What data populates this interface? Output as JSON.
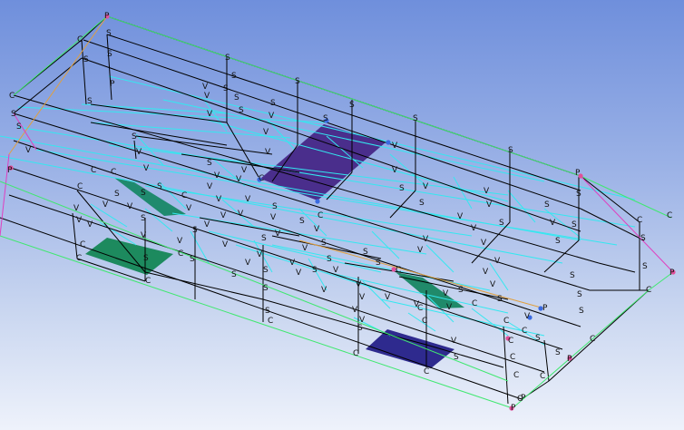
{
  "viewport": {
    "name": "3D mesh viewport",
    "colors": {
      "background_top": "#6f8fdc",
      "background_bottom": "#eef2fb",
      "frame_black": "#000000",
      "interior_cyan": "#33e8f0",
      "boundary_green": "#40e870",
      "boundary_magenta": "#e040c0",
      "boundary_orange": "#e0a040",
      "face_purple": "#4a2e8c",
      "face_navy": "#2e2a8e",
      "face_green": "#208a6a"
    }
  },
  "entity_labels": {
    "column": "C",
    "shell": "S",
    "vertex": "V",
    "point": "P"
  },
  "highlighted_faces": [
    {
      "id": "face-purple-top",
      "color": "#4a2e8c"
    },
    {
      "id": "face-navy-bottom",
      "color": "#2e2a8e"
    },
    {
      "id": "face-green-left-upper",
      "color": "#1f8a6e"
    },
    {
      "id": "face-green-left-lower",
      "color": "#1d8a5e"
    },
    {
      "id": "face-green-right",
      "color": "#208a6a"
    }
  ]
}
